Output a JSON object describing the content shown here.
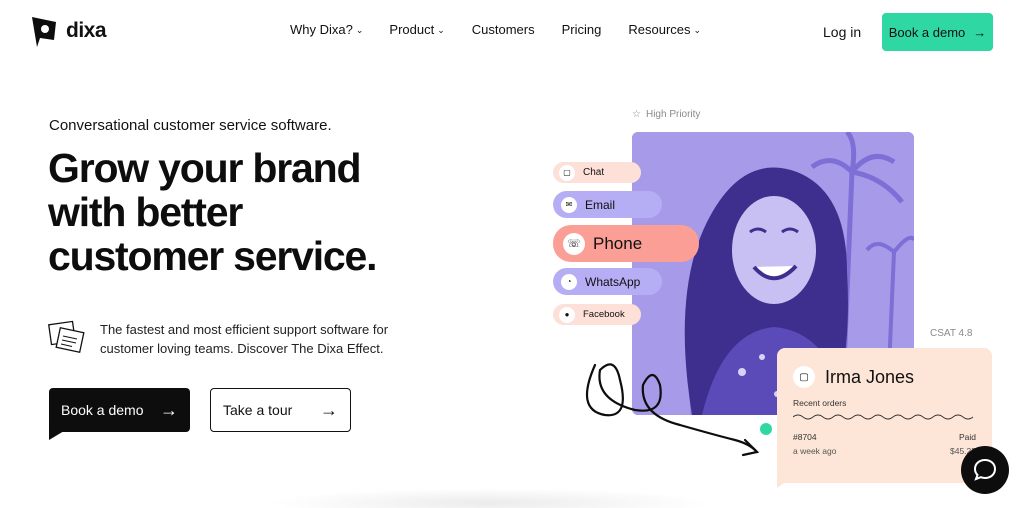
{
  "brand": {
    "name": "dixa",
    "accent": "#2fd8a2",
    "dark": "#0d0d0d"
  },
  "nav": {
    "items": [
      {
        "label": "Why Dixa?",
        "dropdown": true
      },
      {
        "label": "Product",
        "dropdown": true
      },
      {
        "label": "Customers",
        "dropdown": false
      },
      {
        "label": "Pricing",
        "dropdown": false
      },
      {
        "label": "Resources",
        "dropdown": true
      }
    ],
    "login": "Log in",
    "cta": "Book a demo"
  },
  "hero": {
    "eyebrow": "Conversational customer service software.",
    "headline": [
      "Grow your brand",
      "with better",
      "customer service."
    ],
    "feature_text": "The fastest and most efficient support software for customer loving teams. Discover The Dixa Effect.",
    "primary_button": "Book a demo",
    "secondary_button": "Take a tour"
  },
  "visual": {
    "priority": "High Priority",
    "channels": [
      "Chat",
      "Email",
      "Phone",
      "WhatsApp",
      "Facebook"
    ],
    "csat": "CSAT 4.8",
    "card": {
      "name": "Irma Jones",
      "section": "Recent orders",
      "order_id": "#8704",
      "order_status": "Paid",
      "order_time": "a week ago",
      "order_amount": "$45.25"
    }
  },
  "colors": {
    "lavender": "#b5aef4",
    "peach": "#fde0d8",
    "coral": "#fb9e96",
    "photo_tint": "#a79be9"
  }
}
